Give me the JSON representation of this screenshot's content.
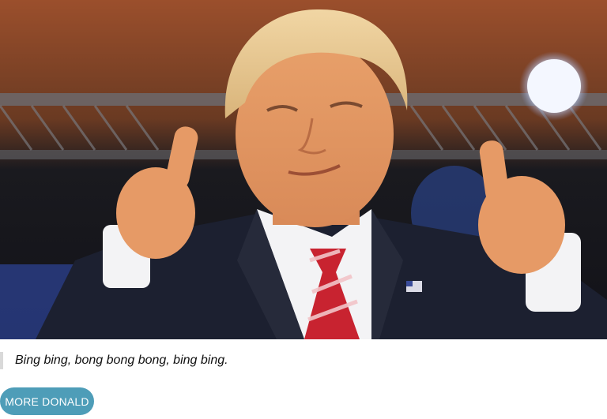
{
  "photo": {
    "icon": "photo-thumbs-up-portrait"
  },
  "quote": {
    "text": "Bing bing, bong bong bong, bing bing."
  },
  "button": {
    "label": "MORE DONALD"
  },
  "colors": {
    "button_bg": "#4e9db8",
    "quote_bar": "#d9d9d9",
    "text": "#111111"
  }
}
